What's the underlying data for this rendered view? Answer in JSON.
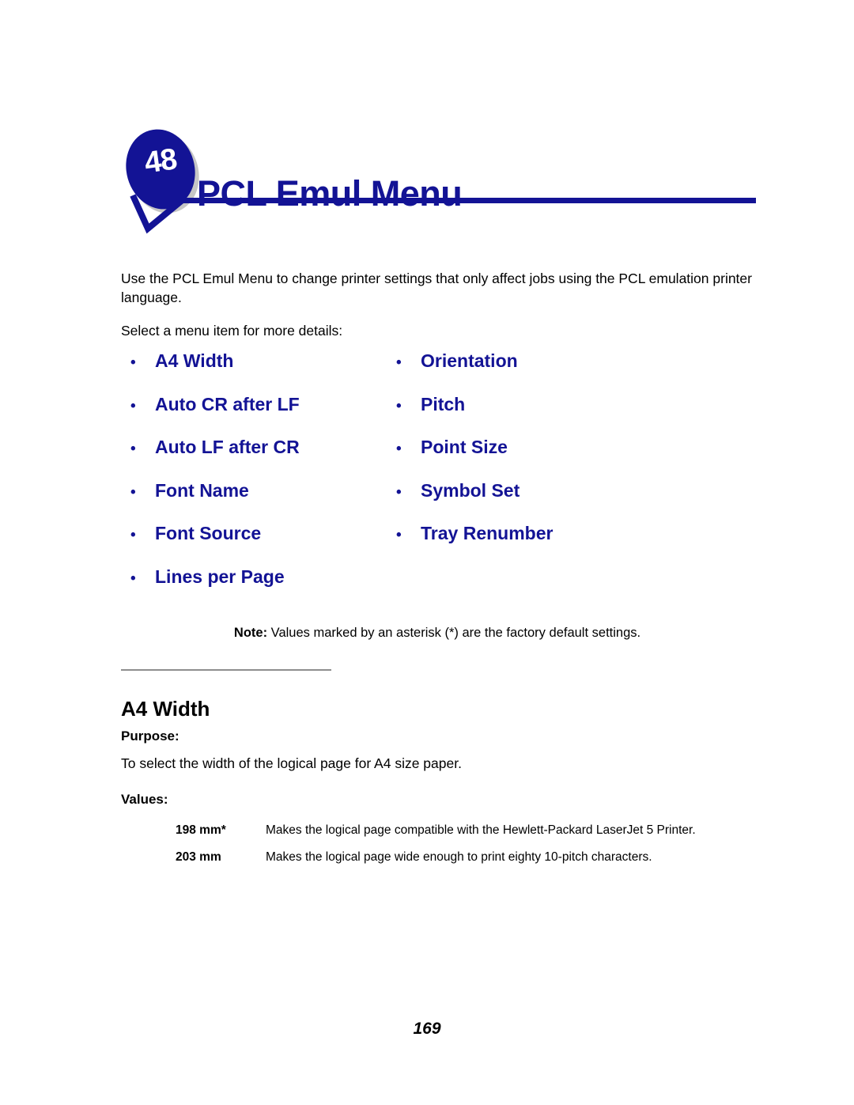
{
  "header": {
    "chapter_number": "48",
    "title": "PCL Emul Menu",
    "accent_color": "#131395",
    "badge_shadow_color": "#c6c6c6",
    "badge_number_color": "#ffffff"
  },
  "intro": {
    "paragraph": "Use the PCL Emul Menu to change printer settings that only affect jobs using the PCL emulation printer language.",
    "instruction": "Select a menu item for more details:"
  },
  "menu_links": {
    "bullet_glyph": "•",
    "left_column": [
      {
        "label": "A4 Width"
      },
      {
        "label": "Auto CR after LF"
      },
      {
        "label": "Auto LF after CR"
      },
      {
        "label": "Font Name"
      },
      {
        "label": "Font Source"
      },
      {
        "label": "Lines per Page"
      }
    ],
    "right_column": [
      {
        "label": "Orientation"
      },
      {
        "label": "Pitch"
      },
      {
        "label": "Point Size"
      },
      {
        "label": "Symbol Set"
      },
      {
        "label": "Tray Renumber"
      }
    ]
  },
  "note": {
    "label": "Note:",
    "text": "Values marked by an asterisk (*) are the factory default settings."
  },
  "section": {
    "heading": "A4 Width",
    "purpose_label": "Purpose:",
    "purpose_text": "To select the width of the logical page for A4 size paper.",
    "values_label": "Values:",
    "values": [
      {
        "name": "198 mm*",
        "description": "Makes the logical page compatible with the Hewlett-Packard LaserJet 5 Printer."
      },
      {
        "name": "203 mm",
        "description": "Makes the logical page wide enough to print eighty 10-pitch characters."
      }
    ]
  },
  "footer": {
    "page_number": "169"
  }
}
